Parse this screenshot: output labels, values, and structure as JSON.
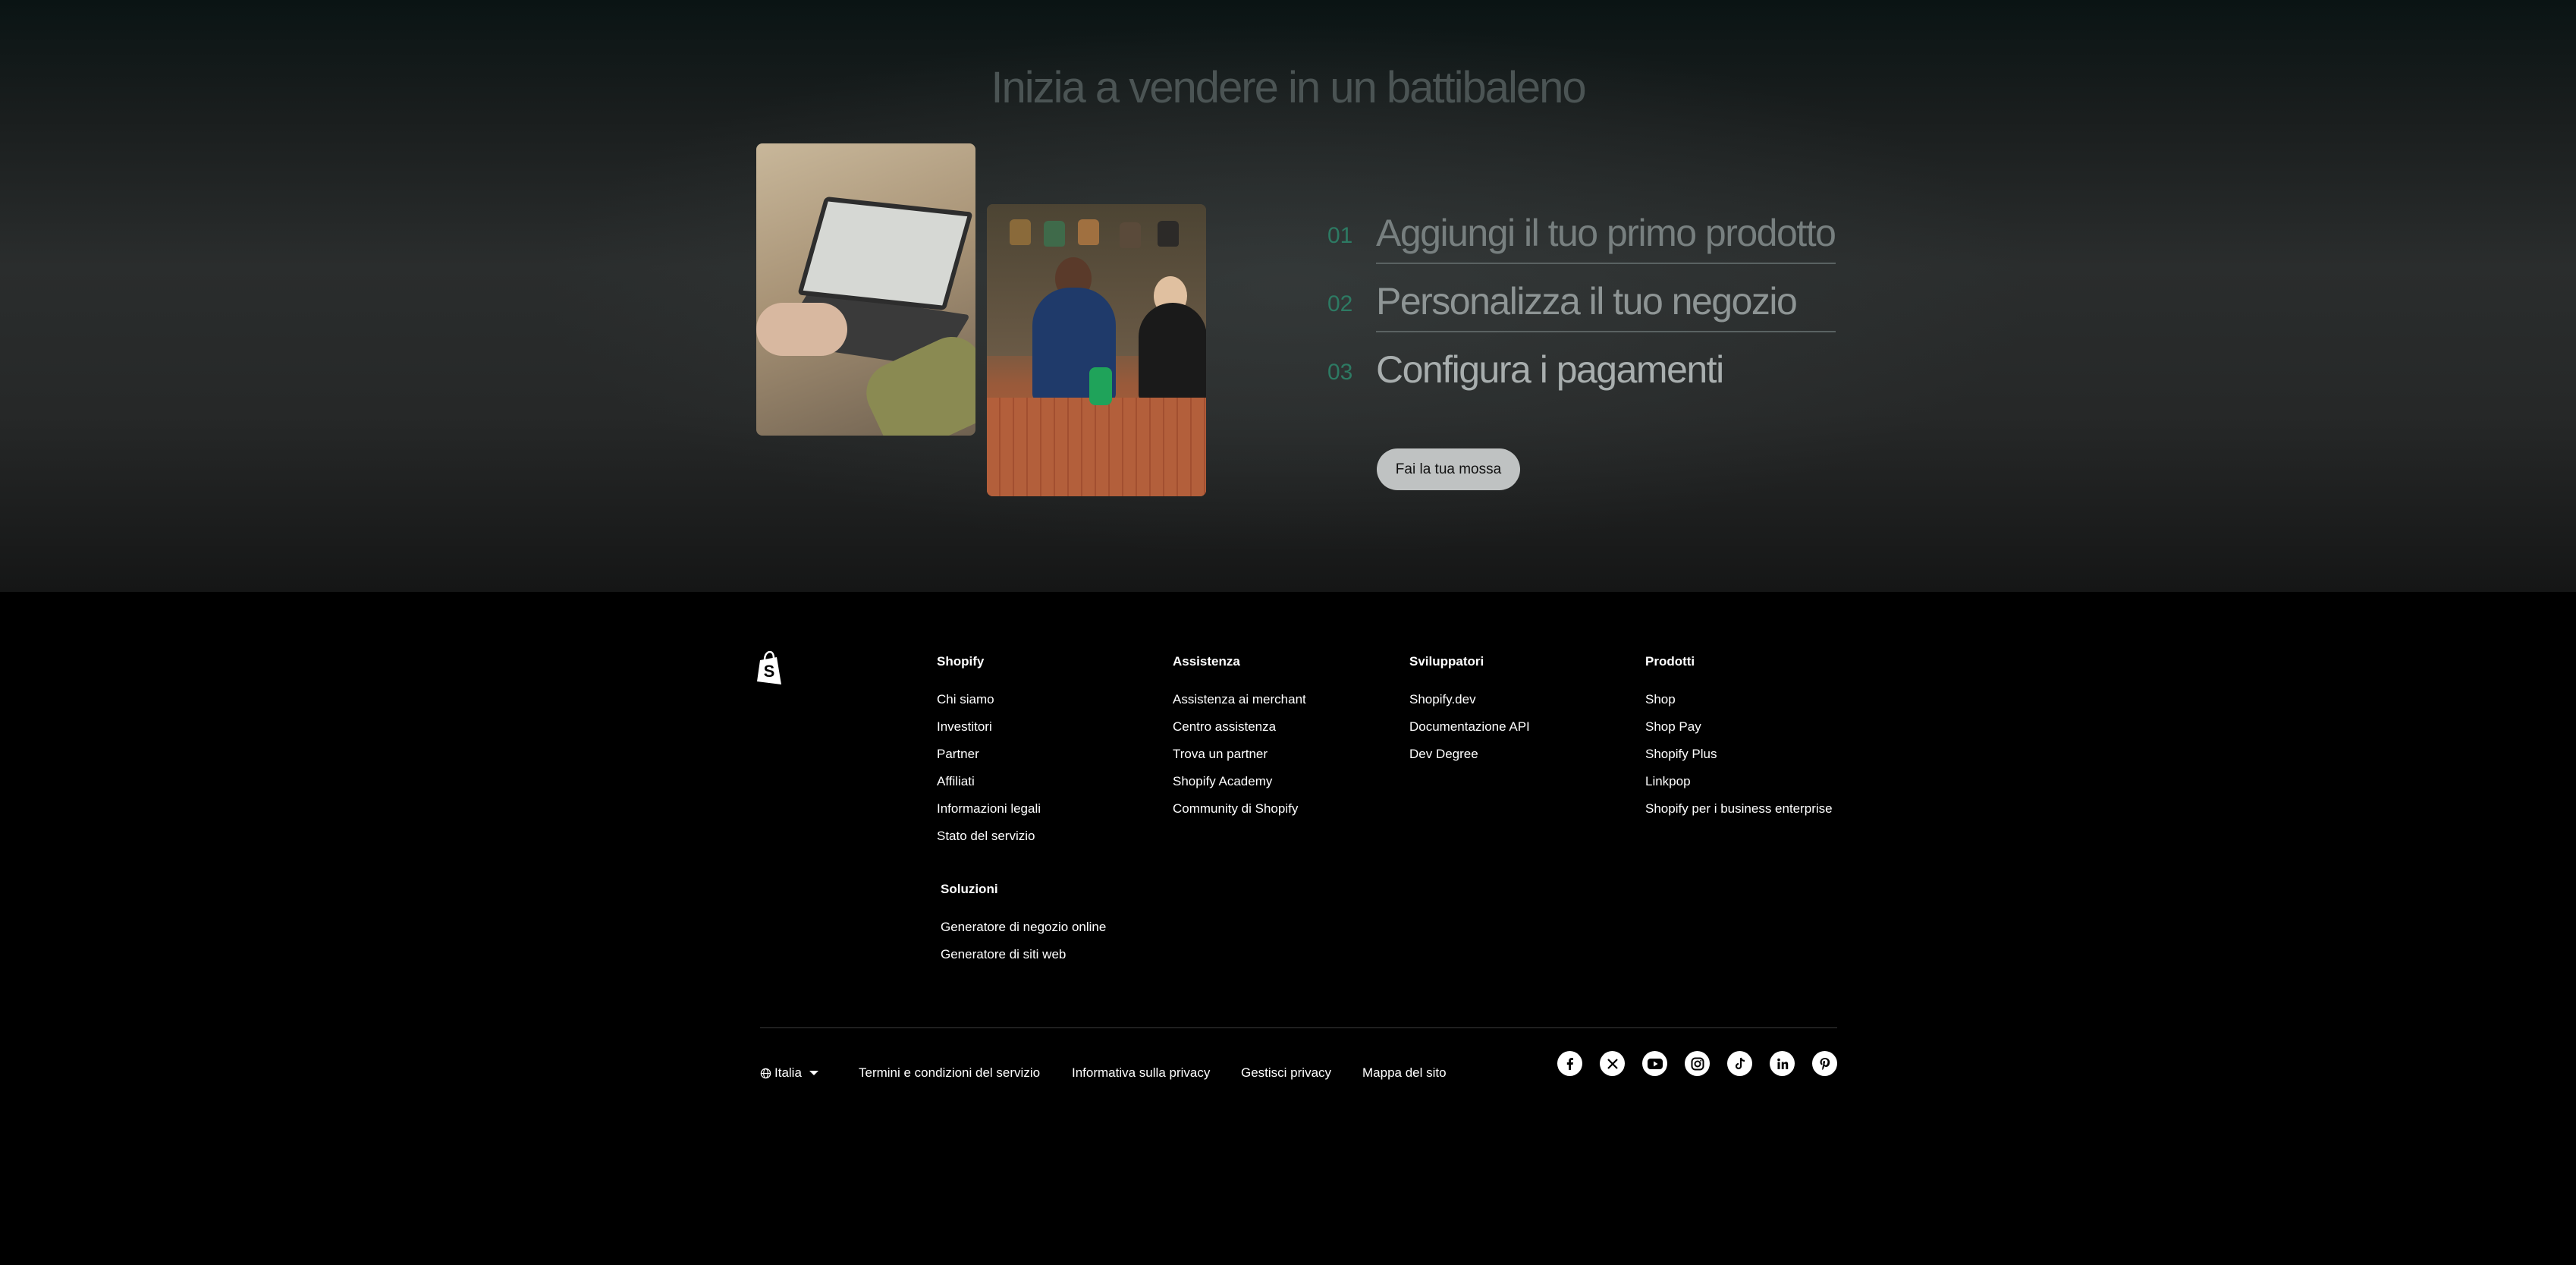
{
  "hero": {
    "title": "Inizia a vendere in un battibaleno",
    "steps": [
      {
        "num": "01",
        "label": "Aggiungi il tuo primo prodotto"
      },
      {
        "num": "02",
        "label": "Personalizza il tuo negozio"
      },
      {
        "num": "03",
        "label": "Configura i pagamenti"
      }
    ],
    "cta": "Fai la tua mossa"
  },
  "footer": {
    "columns": [
      {
        "title": "Shopify",
        "items": [
          "Chi siamo",
          "Investitori",
          "Partner",
          "Affiliati",
          "Informazioni legali",
          "Stato del servizio"
        ]
      },
      {
        "title": "Assistenza",
        "items": [
          "Assistenza ai merchant",
          "Centro assistenza",
          "Trova un partner",
          "Shopify Academy",
          "Community di Shopify"
        ]
      },
      {
        "title": "Sviluppatori",
        "items": [
          "Shopify.dev",
          "Documentazione API",
          "Dev Degree"
        ]
      },
      {
        "title": "Prodotti",
        "items": [
          "Shop",
          "Shop Pay",
          "Shopify Plus",
          "Linkpop",
          "Shopify per i business enterprise"
        ]
      },
      {
        "title": "Soluzioni",
        "items": [
          "Generatore di negozio online",
          "Generatore di siti web"
        ]
      }
    ],
    "language": "Italia",
    "legal_links": [
      "Termini e condizioni del servizio",
      "Informativa sulla privacy",
      "Gestisci privacy",
      "Mappa del sito"
    ],
    "social_icons": [
      "facebook-icon",
      "x-icon",
      "youtube-icon",
      "instagram-icon",
      "tiktok-icon",
      "linkedin-icon",
      "pinterest-icon"
    ]
  }
}
